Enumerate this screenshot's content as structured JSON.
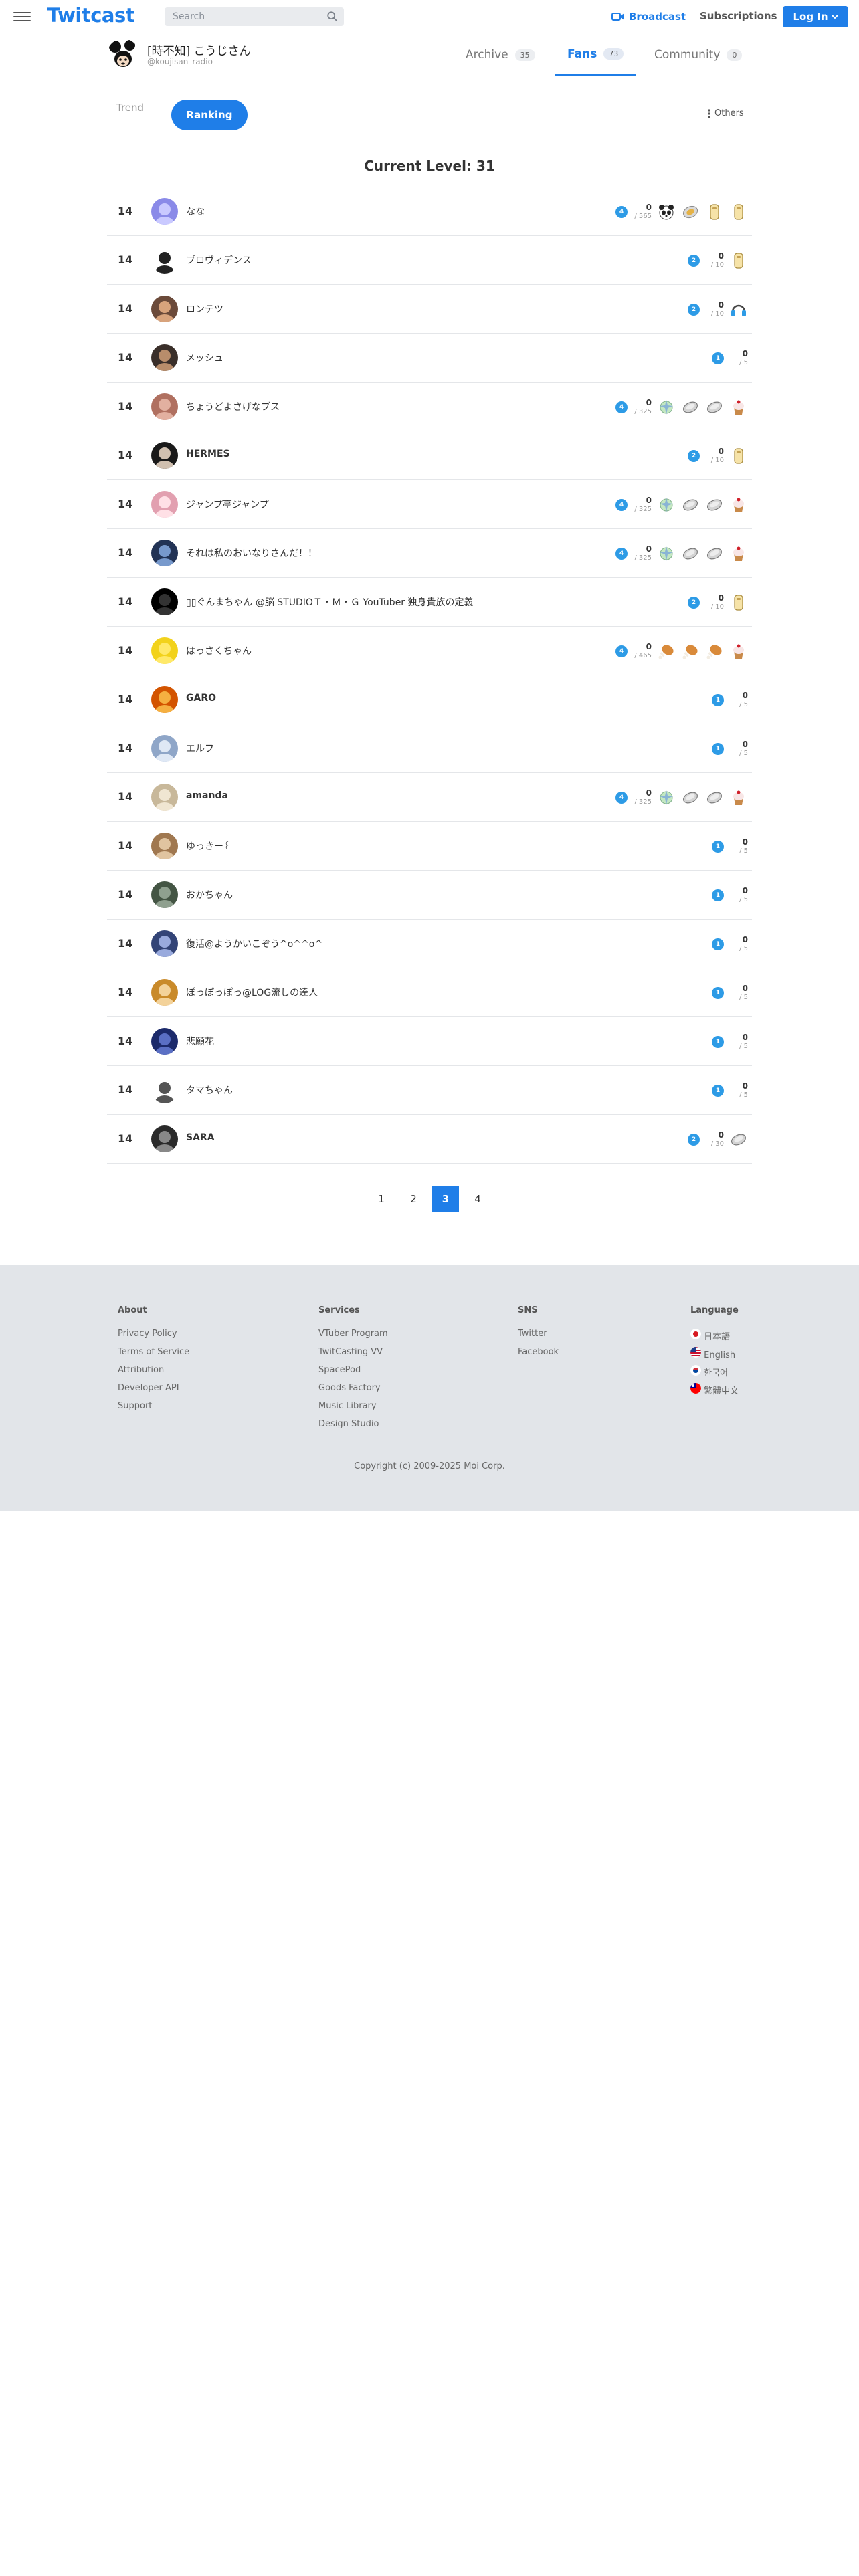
{
  "header": {
    "logo": "Twitcast",
    "search_placeholder": "Search",
    "broadcast": "Broadcast",
    "subscriptions": "Subscriptions",
    "login": "Log In"
  },
  "profile": {
    "name": "[時不知] こうじさん",
    "id": "@koujisan_radio",
    "tabs": [
      {
        "label": "Archive",
        "count": "35"
      },
      {
        "label": "Fans",
        "count": "73"
      },
      {
        "label": "Community",
        "count": "0"
      }
    ]
  },
  "filters": {
    "trend": "Trend",
    "ranking": "Ranking",
    "others": "Others"
  },
  "level_title": "Current Level: 31",
  "fans": [
    {
      "rank": "14",
      "name": "なな",
      "level": "4",
      "score": "0",
      "max": "/ 565",
      "gifts": [
        "panda-gift",
        "onigiri-gift",
        "tag-gift",
        "tag-gift"
      ]
    },
    {
      "rank": "14",
      "name": "プロヴィデンス",
      "level": "2",
      "score": "0",
      "max": "/ 10",
      "gifts": [
        "tag-gift"
      ]
    },
    {
      "rank": "14",
      "name": "ロンテツ",
      "level": "2",
      "score": "0",
      "max": "/ 10",
      "gifts": [
        "headphone-gift"
      ]
    },
    {
      "rank": "14",
      "name": "メッシュ",
      "level": "1",
      "score": "0",
      "max": "/ 5",
      "gifts": []
    },
    {
      "rank": "14",
      "name": "ちょうどよさげなブス",
      "level": "4",
      "score": "0",
      "max": "/ 325",
      "gifts": [
        "sparkle-gift",
        "coin-gift",
        "coin-gift",
        "cupcake-gift"
      ]
    },
    {
      "rank": "14",
      "name": "HERMES",
      "level": "2",
      "score": "0",
      "max": "/ 10",
      "gifts": [
        "tag-gift"
      ]
    },
    {
      "rank": "14",
      "name": "ジャンプ亭ジャンプ",
      "level": "4",
      "score": "0",
      "max": "/ 325",
      "gifts": [
        "sparkle-gift",
        "coin-gift",
        "coin-gift",
        "cupcake-gift"
      ]
    },
    {
      "rank": "14",
      "name": "それは私のおいなりさんだ！！",
      "level": "4",
      "score": "0",
      "max": "/ 325",
      "gifts": [
        "sparkle-gift",
        "coin-gift",
        "coin-gift",
        "cupcake-gift"
      ]
    },
    {
      "rank": "14",
      "name": "▯▯ぐんまちゃん @脳 STUDIOＴ・Ｍ・Ｇ YouTuber 独身貴族の定義",
      "level": "2",
      "score": "0",
      "max": "/ 10",
      "gifts": [
        "tag-gift"
      ]
    },
    {
      "rank": "14",
      "name": "はっさくちゃん",
      "level": "4",
      "score": "0",
      "max": "/ 465",
      "gifts": [
        "drumstick-gift",
        "drumstick-gift",
        "drumstick-gift",
        "cupcake-gift"
      ]
    },
    {
      "rank": "14",
      "name": "GARO",
      "level": "1",
      "score": "0",
      "max": "/ 5",
      "gifts": []
    },
    {
      "rank": "14",
      "name": "エルフ",
      "level": "1",
      "score": "0",
      "max": "/ 5",
      "gifts": []
    },
    {
      "rank": "14",
      "name": "amanda",
      "level": "4",
      "score": "0",
      "max": "/ 325",
      "gifts": [
        "sparkle-gift",
        "coin-gift",
        "coin-gift",
        "cupcake-gift"
      ]
    },
    {
      "rank": "14",
      "name": "ゆっきー꒰",
      "level": "1",
      "score": "0",
      "max": "/ 5",
      "gifts": []
    },
    {
      "rank": "14",
      "name": "おかちゃん",
      "level": "1",
      "score": "0",
      "max": "/ 5",
      "gifts": []
    },
    {
      "rank": "14",
      "name": "復活@ようかいこぞう^o^^o^",
      "level": "1",
      "score": "0",
      "max": "/ 5",
      "gifts": []
    },
    {
      "rank": "14",
      "name": "ぽっぽっぽっ@LOG流しの達人",
      "level": "1",
      "score": "0",
      "max": "/ 5",
      "gifts": []
    },
    {
      "rank": "14",
      "name": "悲願花",
      "level": "1",
      "score": "0",
      "max": "/ 5",
      "gifts": []
    },
    {
      "rank": "14",
      "name": "タマちゃん",
      "level": "1",
      "score": "0",
      "max": "/ 5",
      "gifts": []
    },
    {
      "rank": "14",
      "name": "SARA",
      "level": "2",
      "score": "0",
      "max": "/ 30",
      "gifts": [
        "coin-gift"
      ]
    }
  ],
  "pagination": {
    "pages": [
      "1",
      "2",
      "3",
      "4"
    ],
    "current": "3"
  },
  "footer": {
    "about": {
      "title": "About",
      "links": [
        "Privacy Policy",
        "Terms of Service",
        "Attribution",
        "Developer API",
        "Support"
      ]
    },
    "services": {
      "title": "Services",
      "links": [
        "VTuber Program",
        "TwitCasting VV",
        "SpacePod",
        "Goods Factory",
        "Music Library",
        "Design Studio"
      ]
    },
    "sns": {
      "title": "SNS",
      "links": [
        "Twitter",
        "Facebook"
      ]
    },
    "language": {
      "title": "Language",
      "links": [
        "日本語",
        "English",
        "한국어",
        "繁體中文"
      ]
    },
    "copyright": "Copyright (c) 2009-2025 Moi Corp."
  },
  "colors": {
    "accent": "#1f7ee8",
    "level_badge": "#2d9be6",
    "footer_bg": "#e2e5e9"
  }
}
